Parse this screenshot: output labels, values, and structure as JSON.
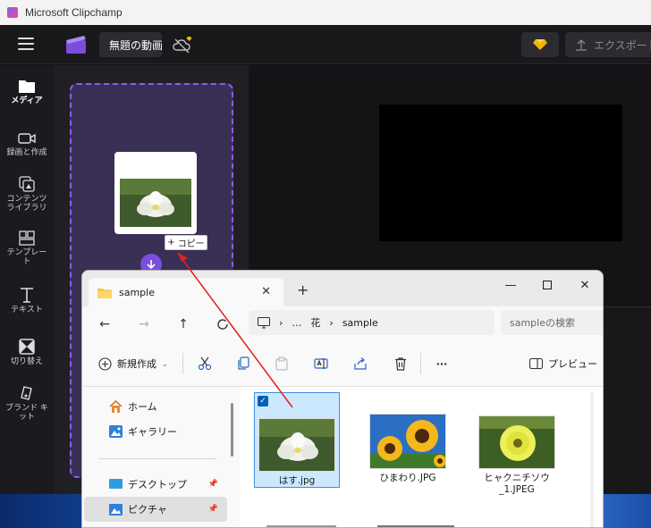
{
  "clipchamp": {
    "window_title": "Microsoft Clipchamp",
    "project_title": "無題の動画",
    "export_label": "エクスポート",
    "colors": {
      "accent": "#8b5cf6",
      "background": "#111114"
    },
    "rail": [
      {
        "label": "メディア",
        "icon": "folder-icon",
        "active": true
      },
      {
        "label": "録画と作成",
        "icon": "camera-icon"
      },
      {
        "label": "コンテンツ ライブラリ",
        "icon": "library-icon"
      },
      {
        "label": "テンプレート",
        "icon": "template-icon"
      },
      {
        "label": "テキスト",
        "icon": "text-icon"
      },
      {
        "label": "切り替え",
        "icon": "transition-icon"
      },
      {
        "label": "ブランド キット",
        "icon": "brand-kit-icon"
      }
    ],
    "drag": {
      "copy_label": "コピー"
    }
  },
  "explorer": {
    "tab_title": "sample",
    "breadcrumb": [
      "…",
      "花",
      "sample"
    ],
    "search_placeholder": "sampleの検索",
    "new_label": "新規作成",
    "preview_label": "プレビュー",
    "sidebar": [
      {
        "label": "ホーム",
        "icon": "home-icon"
      },
      {
        "label": "ギャラリー",
        "icon": "gallery-icon"
      },
      {
        "label": "デスクトップ",
        "icon": "desktop-icon",
        "pinned": true
      },
      {
        "label": "ピクチャ",
        "icon": "pictures-icon",
        "pinned": true,
        "selected": true
      }
    ],
    "files": [
      {
        "name": "はす.jpg",
        "selected": true,
        "subject": "lotus"
      },
      {
        "name": "ひまわり.JPG",
        "selected": false,
        "subject": "sunflower"
      },
      {
        "name": "ヒャクニチソウ_1.JPEG",
        "selected": false,
        "subject": "zinnia"
      }
    ]
  }
}
